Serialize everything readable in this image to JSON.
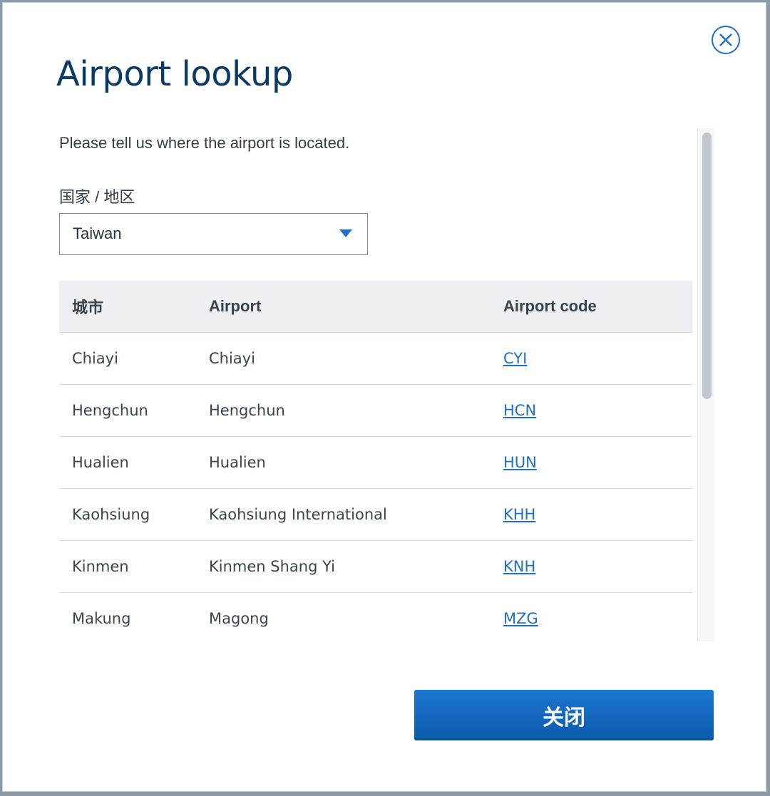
{
  "dialog": {
    "title": "Airport lookup",
    "intro": "Please tell us where the airport is located.",
    "country_label": "国家 / 地区",
    "country_value": "Taiwan",
    "close_button_label": "关闭"
  },
  "table": {
    "headers": [
      "城市",
      "Airport",
      "Airport code"
    ],
    "rows": [
      {
        "city": "Chiayi",
        "airport": "Chiayi",
        "code": "CYI"
      },
      {
        "city": "Hengchun",
        "airport": "Hengchun",
        "code": "HCN"
      },
      {
        "city": "Hualien",
        "airport": "Hualien",
        "code": "HUN"
      },
      {
        "city": "Kaohsiung",
        "airport": "Kaohsiung International",
        "code": "KHH"
      },
      {
        "city": "Kinmen",
        "airport": "Kinmen Shang Yi",
        "code": "KNH"
      },
      {
        "city": "Makung",
        "airport": "Magong",
        "code": "MZG"
      }
    ]
  },
  "colors": {
    "accent": "#1f6fc2",
    "title": "#0b3a64",
    "header_bg": "#edeff2"
  },
  "icons": {
    "close": "close-circle-icon",
    "dropdown": "caret-down-icon"
  }
}
